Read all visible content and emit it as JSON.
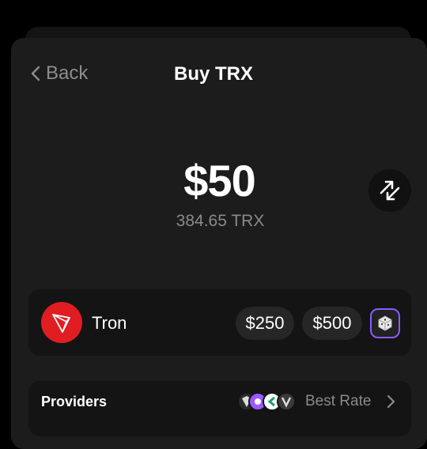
{
  "header": {
    "back_label": "Back",
    "title": "Buy TRX"
  },
  "amount": {
    "fiat": "$50",
    "crypto": "384.65 TRX"
  },
  "asset": {
    "name": "Tron",
    "logo_color": "#e01e22"
  },
  "presets": [
    "$250",
    "$500"
  ],
  "providers": {
    "label": "Providers",
    "best_rate_label": "Best Rate",
    "provider_icon_colors": [
      "#2b2b2b",
      "#9b59ff",
      "#ffffff",
      "#3a3a3a"
    ]
  },
  "colors": {
    "background": "#000000",
    "sheet": "#1c1c1c",
    "row": "#141414",
    "muted_text": "#8a8a8a",
    "accent_border": "#8a5cff"
  }
}
